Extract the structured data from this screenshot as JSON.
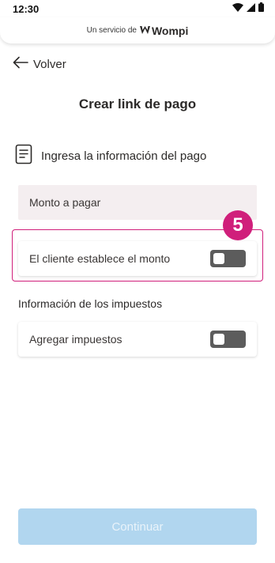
{
  "status_bar": {
    "time": "12:30",
    "icons": [
      "wifi-icon",
      "signal-icon",
      "battery-icon"
    ]
  },
  "header": {
    "service_text": "Un servicio de",
    "brand_name": "Wompi"
  },
  "nav": {
    "back_label": "Volver"
  },
  "page": {
    "title": "Crear link de pago",
    "section_label": "Ingresa la información del pago",
    "section_icon": "document-icon"
  },
  "form": {
    "amount_placeholder": "Monto a pagar",
    "client_amount_label": "El cliente establece el monto",
    "client_amount_enabled": false,
    "tax_heading": "Información de los impuestos",
    "add_tax_label": "Agregar impuestos",
    "add_tax_enabled": false
  },
  "annotation": {
    "step_number": "5"
  },
  "footer": {
    "continue_label": "Continuar",
    "continue_disabled": true
  },
  "colors": {
    "accent": "#d01f7b",
    "button_disabled_bg": "#b1d6ef",
    "field_bg": "#f4eef0",
    "switch_off": "#5c5c5c"
  }
}
